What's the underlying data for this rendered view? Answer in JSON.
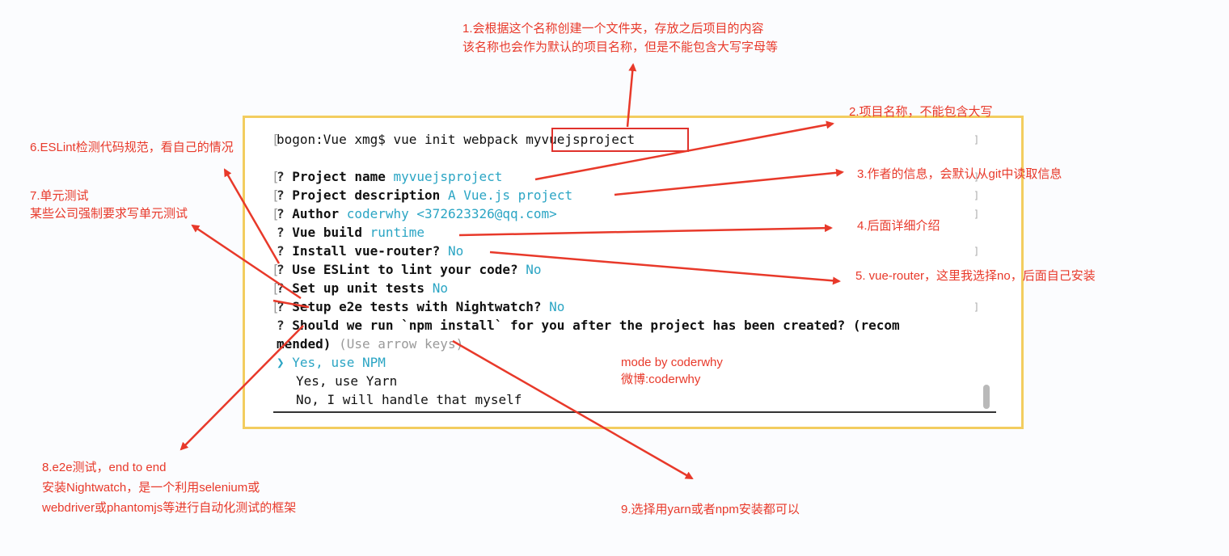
{
  "terminal": {
    "command_prefix": "bogon:Vue xmg$ vue init webpack ",
    "project_arg": "myvuejsproject",
    "lines": [
      {
        "mark": "?",
        "label": "Project name",
        "value": "myvuejsproject"
      },
      {
        "mark": "?",
        "label": "Project description",
        "value": "A Vue.js project"
      },
      {
        "mark": "?",
        "label": "Author",
        "value": "coderwhy <372623326@qq.com>"
      },
      {
        "mark": "?",
        "label": "Vue build",
        "value": "runtime"
      },
      {
        "mark": "?",
        "label": "Install vue-router?",
        "value": "No"
      },
      {
        "mark": "?",
        "label": "Use ESLint to lint your code?",
        "value": "No"
      },
      {
        "mark": "?",
        "label": "Set up unit tests",
        "value": "No"
      },
      {
        "mark": "?",
        "label": "Setup e2e tests with Nightwatch?",
        "value": "No"
      }
    ],
    "question_line1": "Should we run `npm install` for you after the project has been created? (recom",
    "question_line2": "mended)",
    "question_hint": "(Use arrow keys)",
    "options": [
      {
        "pointer": "❯",
        "label": "Yes, use NPM"
      },
      {
        "pointer": "",
        "label": "Yes, use Yarn"
      },
      {
        "pointer": "",
        "label": "No, I will handle that myself"
      }
    ]
  },
  "annotations": {
    "a1_line1": "1.会根据这个名称创建一个文件夹，存放之后项目的内容",
    "a1_line2": "该名称也会作为默认的项目名称，但是不能包含大写字母等",
    "a2": "2.项目名称，不能包含大写",
    "a3": "3.作者的信息，会默认从git中读取信息",
    "a4": "4.后面详细介绍",
    "a5": "5. vue-router，这里我选择no，后面自己安装",
    "a6": "6.ESLint检测代码规范，看自己的情况",
    "a7_line1": "7.单元测试",
    "a7_line2": "某些公司强制要求写单元测试",
    "a8_line1": "8.e2e测试，end to end",
    "a8_line2": "安装Nightwatch，是一个利用selenium或",
    "a8_line3": "webdriver或phantomjs等进行自动化测试的框架",
    "a9": "9.选择用yarn或者npm安装都可以",
    "credit_line1": "mode by coderwhy",
    "credit_line2": "微博:coderwhy"
  },
  "colors": {
    "annotation": "#e8392a",
    "frame": "#f3cd5f",
    "terminal_value": "#2ba5c4"
  }
}
